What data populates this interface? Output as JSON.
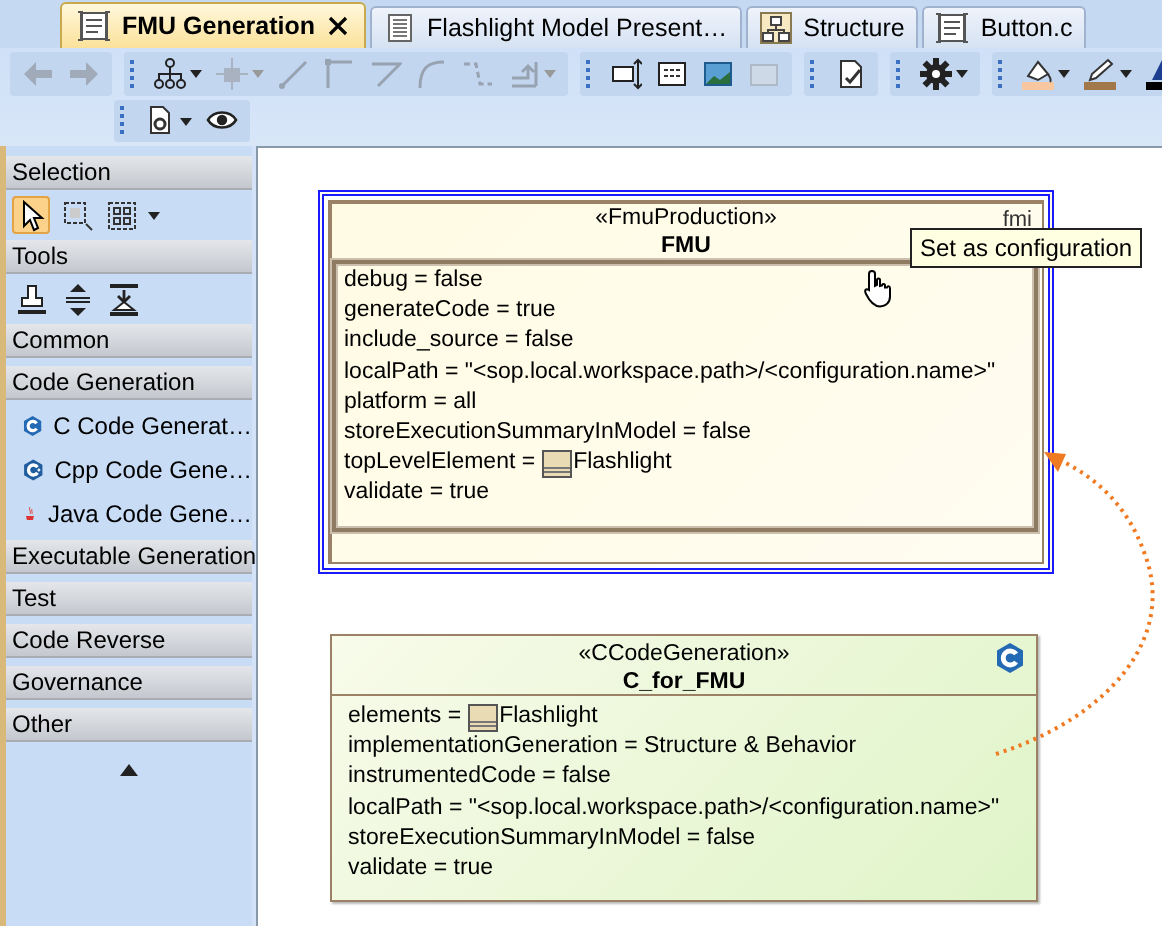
{
  "tabs": [
    {
      "label": "FMU Generation",
      "kind": "diagram",
      "selected": true,
      "closable": true
    },
    {
      "label": "Flashlight Model Present…",
      "kind": "document",
      "selected": false,
      "closable": false
    },
    {
      "label": "Structure",
      "kind": "structure",
      "selected": false,
      "closable": false
    },
    {
      "label": "Button.c",
      "kind": "diagram",
      "selected": false,
      "closable": false
    }
  ],
  "toolbar": {
    "rows": [
      [
        [
          {
            "kind": "back",
            "disabled": true,
            "menu": false
          },
          {
            "kind": "forward",
            "disabled": true,
            "menu": false
          }
        ],
        [
          {
            "kind": "hierarchy",
            "disabled": false,
            "menu": true
          },
          {
            "kind": "node-add",
            "disabled": true,
            "menu": true
          },
          {
            "kind": "line",
            "disabled": true,
            "menu": false
          },
          {
            "kind": "elbow",
            "disabled": true,
            "menu": false
          },
          {
            "kind": "bent",
            "disabled": true,
            "menu": false
          },
          {
            "kind": "curve",
            "disabled": true,
            "menu": false
          },
          {
            "kind": "zigzag",
            "disabled": true,
            "menu": false
          },
          {
            "kind": "insert",
            "disabled": true,
            "menu": true
          }
        ],
        [
          {
            "kind": "resize",
            "disabled": false,
            "menu": false
          },
          {
            "kind": "table",
            "disabled": false,
            "menu": false
          },
          {
            "kind": "image",
            "disabled": false,
            "menu": false
          },
          {
            "kind": "frame",
            "disabled": true,
            "menu": false
          }
        ],
        [
          {
            "kind": "validate",
            "disabled": false,
            "menu": false
          }
        ],
        [
          {
            "kind": "gear",
            "disabled": false,
            "menu": true
          }
        ],
        [
          {
            "kind": "fill",
            "disabled": false,
            "menu": true
          },
          {
            "kind": "pen",
            "disabled": false,
            "menu": true
          },
          {
            "kind": "font-color",
            "disabled": false,
            "menu": false
          }
        ]
      ],
      [
        [
          {
            "kind": "doc-gear",
            "disabled": false,
            "menu": true
          },
          {
            "kind": "eye",
            "disabled": false,
            "menu": false
          }
        ]
      ]
    ]
  },
  "palette": {
    "sections": [
      {
        "title": "Selection",
        "tools": [
          {
            "kind": "pointer",
            "selected": true
          },
          {
            "kind": "marquee",
            "selected": false
          },
          {
            "kind": "grid-select",
            "selected": false,
            "menu": true
          }
        ]
      },
      {
        "title": "Tools",
        "tools": [
          {
            "kind": "stamp",
            "selected": false
          },
          {
            "kind": "split",
            "selected": false
          },
          {
            "kind": "align",
            "selected": false
          }
        ]
      },
      {
        "title": "Common"
      },
      {
        "title": "Code Generation",
        "items": [
          {
            "label": "C Code Generat…",
            "kind": "c"
          },
          {
            "label": "Cpp Code Gene…",
            "kind": "cpp"
          },
          {
            "label": "Java Code Gene…",
            "kind": "java"
          }
        ]
      },
      {
        "title": "Executable Generation"
      },
      {
        "title": "Test"
      },
      {
        "title": "Code Reverse"
      },
      {
        "title": "Governance"
      },
      {
        "title": "Other"
      }
    ]
  },
  "diagram": {
    "blocks": [
      {
        "kind": "fmu",
        "stereotype": "«FmuProduction»",
        "name": "FMU",
        "badge": "fmi",
        "selected": true,
        "properties": [
          {
            "text": "debug = false"
          },
          {
            "text": "generateCode = true"
          },
          {
            "text": "include_source = false"
          },
          {
            "text": "localPath = \"<sop.local.workspace.path>/<configuration.name>\""
          },
          {
            "text": "platform = all"
          },
          {
            "text": "storeExecutionSummaryInModel = false"
          },
          {
            "text": "topLevelElement =",
            "ref": "Flashlight"
          },
          {
            "text": "validate = true"
          }
        ]
      },
      {
        "kind": "ccode",
        "stereotype": "«CCodeGeneration»",
        "name": "C_for_FMU",
        "selected": false,
        "properties": [
          {
            "text": "elements =",
            "ref": "Flashlight"
          },
          {
            "text": "implementationGeneration = Structure & Behavior"
          },
          {
            "text": "instrumentedCode = false"
          },
          {
            "text": "localPath = \"<sop.local.workspace.path>/<configuration.name>\""
          },
          {
            "text": "storeExecutionSummaryInModel = false"
          },
          {
            "text": "validate = true"
          }
        ]
      }
    ],
    "tooltip": "Set as configuration"
  }
}
